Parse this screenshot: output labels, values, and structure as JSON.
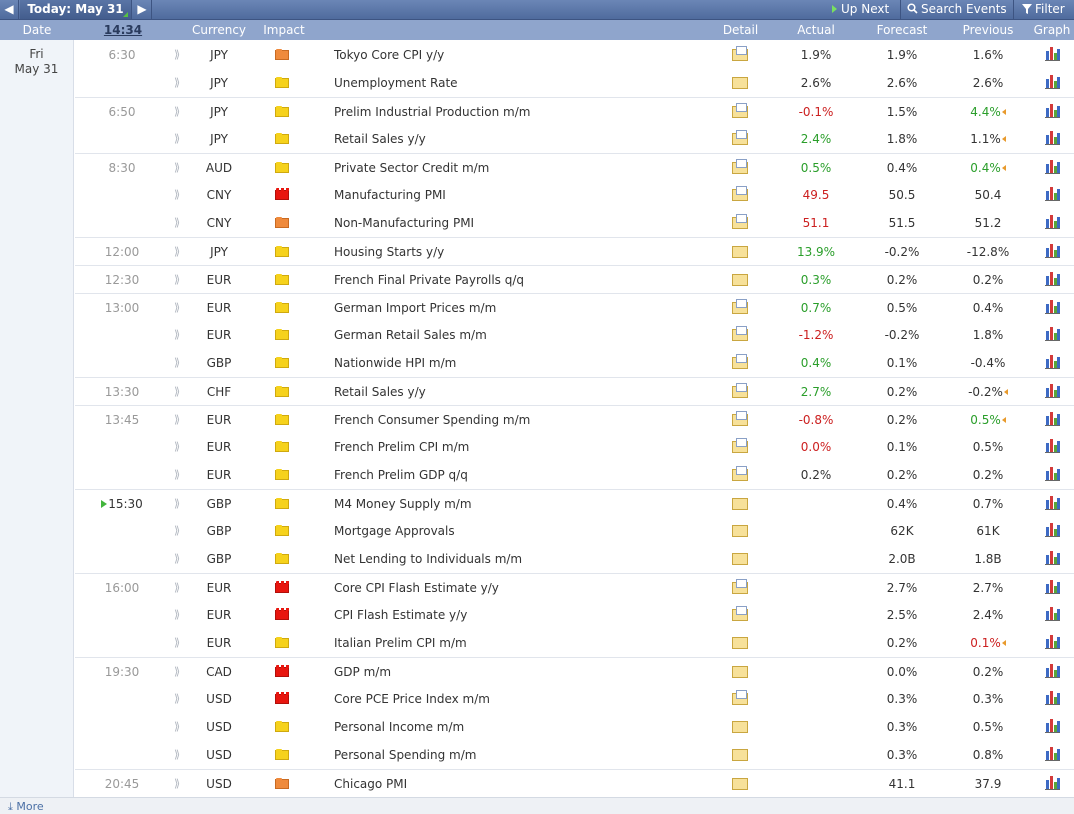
{
  "toolbar": {
    "prev_icon": "◀",
    "today_label": "Today: May 31",
    "next_icon": "▶",
    "up_next_label": "Up Next",
    "search_label": "Search Events",
    "filter_label": "Filter",
    "search_icon": "magnifier-icon",
    "filter_icon": "funnel-icon"
  },
  "header": {
    "date": "Date",
    "time": "14:34",
    "currency": "Currency",
    "impact": "Impact",
    "detail": "Detail",
    "actual": "Actual",
    "forecast": "Forecast",
    "previous": "Previous",
    "graph": "Graph"
  },
  "date_col": {
    "day": "Fri",
    "date": "May 31"
  },
  "colors": {
    "better": "#2a9e2a",
    "worse": "#cc2020",
    "header_bg": "#8fa5cc",
    "toolbar_bg": "#5a75a6"
  },
  "events": [
    {
      "time": "6:30",
      "currency": "JPY",
      "impact": "orange",
      "name": "Tokyo Core CPI y/y",
      "actual": "1.9%",
      "actual_class": "",
      "forecast": "1.9%",
      "previous": "1.6%",
      "prev_class": "",
      "detail": "doc"
    },
    {
      "time": "",
      "currency": "JPY",
      "impact": "yellow",
      "name": "Unemployment Rate",
      "actual": "2.6%",
      "actual_class": "",
      "forecast": "2.6%",
      "previous": "2.6%",
      "prev_class": "",
      "detail": "folder"
    },
    {
      "time": "6:50",
      "currency": "JPY",
      "impact": "yellow",
      "name": "Prelim Industrial Production m/m",
      "actual": "-0.1%",
      "actual_class": "worse",
      "forecast": "1.5%",
      "previous": "4.4%",
      "prev_class": "better",
      "revised": true,
      "detail": "doc"
    },
    {
      "time": "",
      "currency": "JPY",
      "impact": "yellow",
      "name": "Retail Sales y/y",
      "actual": "2.4%",
      "actual_class": "better",
      "forecast": "1.8%",
      "previous": "1.1%",
      "prev_class": "",
      "revised": true,
      "detail": "doc"
    },
    {
      "time": "8:30",
      "currency": "AUD",
      "impact": "yellow",
      "name": "Private Sector Credit m/m",
      "actual": "0.5%",
      "actual_class": "better",
      "forecast": "0.4%",
      "previous": "0.4%",
      "prev_class": "better",
      "revised": true,
      "detail": "doc"
    },
    {
      "time": "",
      "currency": "CNY",
      "impact": "red",
      "name": "Manufacturing PMI",
      "actual": "49.5",
      "actual_class": "worse",
      "forecast": "50.5",
      "previous": "50.4",
      "prev_class": "",
      "detail": "doc"
    },
    {
      "time": "",
      "currency": "CNY",
      "impact": "orange",
      "name": "Non-Manufacturing PMI",
      "actual": "51.1",
      "actual_class": "worse",
      "forecast": "51.5",
      "previous": "51.2",
      "prev_class": "",
      "detail": "doc"
    },
    {
      "time": "12:00",
      "currency": "JPY",
      "impact": "yellow",
      "name": "Housing Starts y/y",
      "actual": "13.9%",
      "actual_class": "better",
      "forecast": "-0.2%",
      "previous": "-12.8%",
      "prev_class": "",
      "detail": "folder"
    },
    {
      "time": "12:30",
      "currency": "EUR",
      "impact": "yellow",
      "name": "French Final Private Payrolls q/q",
      "actual": "0.3%",
      "actual_class": "better",
      "forecast": "0.2%",
      "previous": "0.2%",
      "prev_class": "",
      "detail": "folder"
    },
    {
      "time": "13:00",
      "currency": "EUR",
      "impact": "yellow",
      "name": "German Import Prices m/m",
      "actual": "0.7%",
      "actual_class": "better",
      "forecast": "0.5%",
      "previous": "0.4%",
      "prev_class": "",
      "detail": "doc"
    },
    {
      "time": "",
      "currency": "EUR",
      "impact": "yellow",
      "name": "German Retail Sales m/m",
      "actual": "-1.2%",
      "actual_class": "worse",
      "forecast": "-0.2%",
      "previous": "1.8%",
      "prev_class": "",
      "detail": "doc"
    },
    {
      "time": "",
      "currency": "GBP",
      "impact": "yellow",
      "name": "Nationwide HPI m/m",
      "actual": "0.4%",
      "actual_class": "better",
      "forecast": "0.1%",
      "previous": "-0.4%",
      "prev_class": "",
      "detail": "doc"
    },
    {
      "time": "13:30",
      "currency": "CHF",
      "impact": "yellow",
      "name": "Retail Sales y/y",
      "actual": "2.7%",
      "actual_class": "better",
      "forecast": "0.2%",
      "previous": "-0.2%",
      "prev_class": "",
      "revised": true,
      "detail": "doc"
    },
    {
      "time": "13:45",
      "currency": "EUR",
      "impact": "yellow",
      "name": "French Consumer Spending m/m",
      "actual": "-0.8%",
      "actual_class": "worse",
      "forecast": "0.2%",
      "previous": "0.5%",
      "prev_class": "better",
      "revised": true,
      "detail": "doc"
    },
    {
      "time": "",
      "currency": "EUR",
      "impact": "yellow",
      "name": "French Prelim CPI m/m",
      "actual": "0.0%",
      "actual_class": "worse",
      "forecast": "0.1%",
      "previous": "0.5%",
      "prev_class": "",
      "detail": "doc"
    },
    {
      "time": "",
      "currency": "EUR",
      "impact": "yellow",
      "name": "French Prelim GDP q/q",
      "actual": "0.2%",
      "actual_class": "",
      "forecast": "0.2%",
      "previous": "0.2%",
      "prev_class": "",
      "detail": "doc"
    },
    {
      "time": "15:30",
      "next": true,
      "currency": "GBP",
      "impact": "yellow",
      "name": "M4 Money Supply m/m",
      "actual": "",
      "actual_class": "",
      "forecast": "0.4%",
      "previous": "0.7%",
      "prev_class": "",
      "detail": "folder"
    },
    {
      "time": "",
      "currency": "GBP",
      "impact": "yellow",
      "name": "Mortgage Approvals",
      "actual": "",
      "actual_class": "",
      "forecast": "62K",
      "previous": "61K",
      "prev_class": "",
      "detail": "folder"
    },
    {
      "time": "",
      "currency": "GBP",
      "impact": "yellow",
      "name": "Net Lending to Individuals m/m",
      "actual": "",
      "actual_class": "",
      "forecast": "2.0B",
      "previous": "1.8B",
      "prev_class": "",
      "detail": "folder"
    },
    {
      "time": "16:00",
      "currency": "EUR",
      "impact": "red",
      "name": "Core CPI Flash Estimate y/y",
      "actual": "",
      "actual_class": "",
      "forecast": "2.7%",
      "previous": "2.7%",
      "prev_class": "",
      "detail": "doc"
    },
    {
      "time": "",
      "currency": "EUR",
      "impact": "red",
      "name": "CPI Flash Estimate y/y",
      "actual": "",
      "actual_class": "",
      "forecast": "2.5%",
      "previous": "2.4%",
      "prev_class": "",
      "detail": "doc"
    },
    {
      "time": "",
      "currency": "EUR",
      "impact": "yellow",
      "name": "Italian Prelim CPI m/m",
      "actual": "",
      "actual_class": "",
      "forecast": "0.2%",
      "previous": "0.1%",
      "prev_class": "worse",
      "revised": true,
      "detail": "folder"
    },
    {
      "time": "19:30",
      "currency": "CAD",
      "impact": "red",
      "name": "GDP m/m",
      "actual": "",
      "actual_class": "",
      "forecast": "0.0%",
      "previous": "0.2%",
      "prev_class": "",
      "detail": "folder"
    },
    {
      "time": "",
      "currency": "USD",
      "impact": "red",
      "name": "Core PCE Price Index m/m",
      "actual": "",
      "actual_class": "",
      "forecast": "0.3%",
      "previous": "0.3%",
      "prev_class": "",
      "detail": "doc"
    },
    {
      "time": "",
      "currency": "USD",
      "impact": "yellow",
      "name": "Personal Income m/m",
      "actual": "",
      "actual_class": "",
      "forecast": "0.3%",
      "previous": "0.5%",
      "prev_class": "",
      "detail": "folder"
    },
    {
      "time": "",
      "currency": "USD",
      "impact": "yellow",
      "name": "Personal Spending m/m",
      "actual": "",
      "actual_class": "",
      "forecast": "0.3%",
      "previous": "0.8%",
      "prev_class": "",
      "detail": "folder"
    },
    {
      "time": "20:45",
      "currency": "USD",
      "impact": "orange",
      "name": "Chicago PMI",
      "actual": "",
      "actual_class": "",
      "forecast": "41.1",
      "previous": "37.9",
      "prev_class": "",
      "detail": "folder"
    }
  ],
  "footer": {
    "more_label": "More",
    "more_icon": "download-arrow-icon"
  }
}
